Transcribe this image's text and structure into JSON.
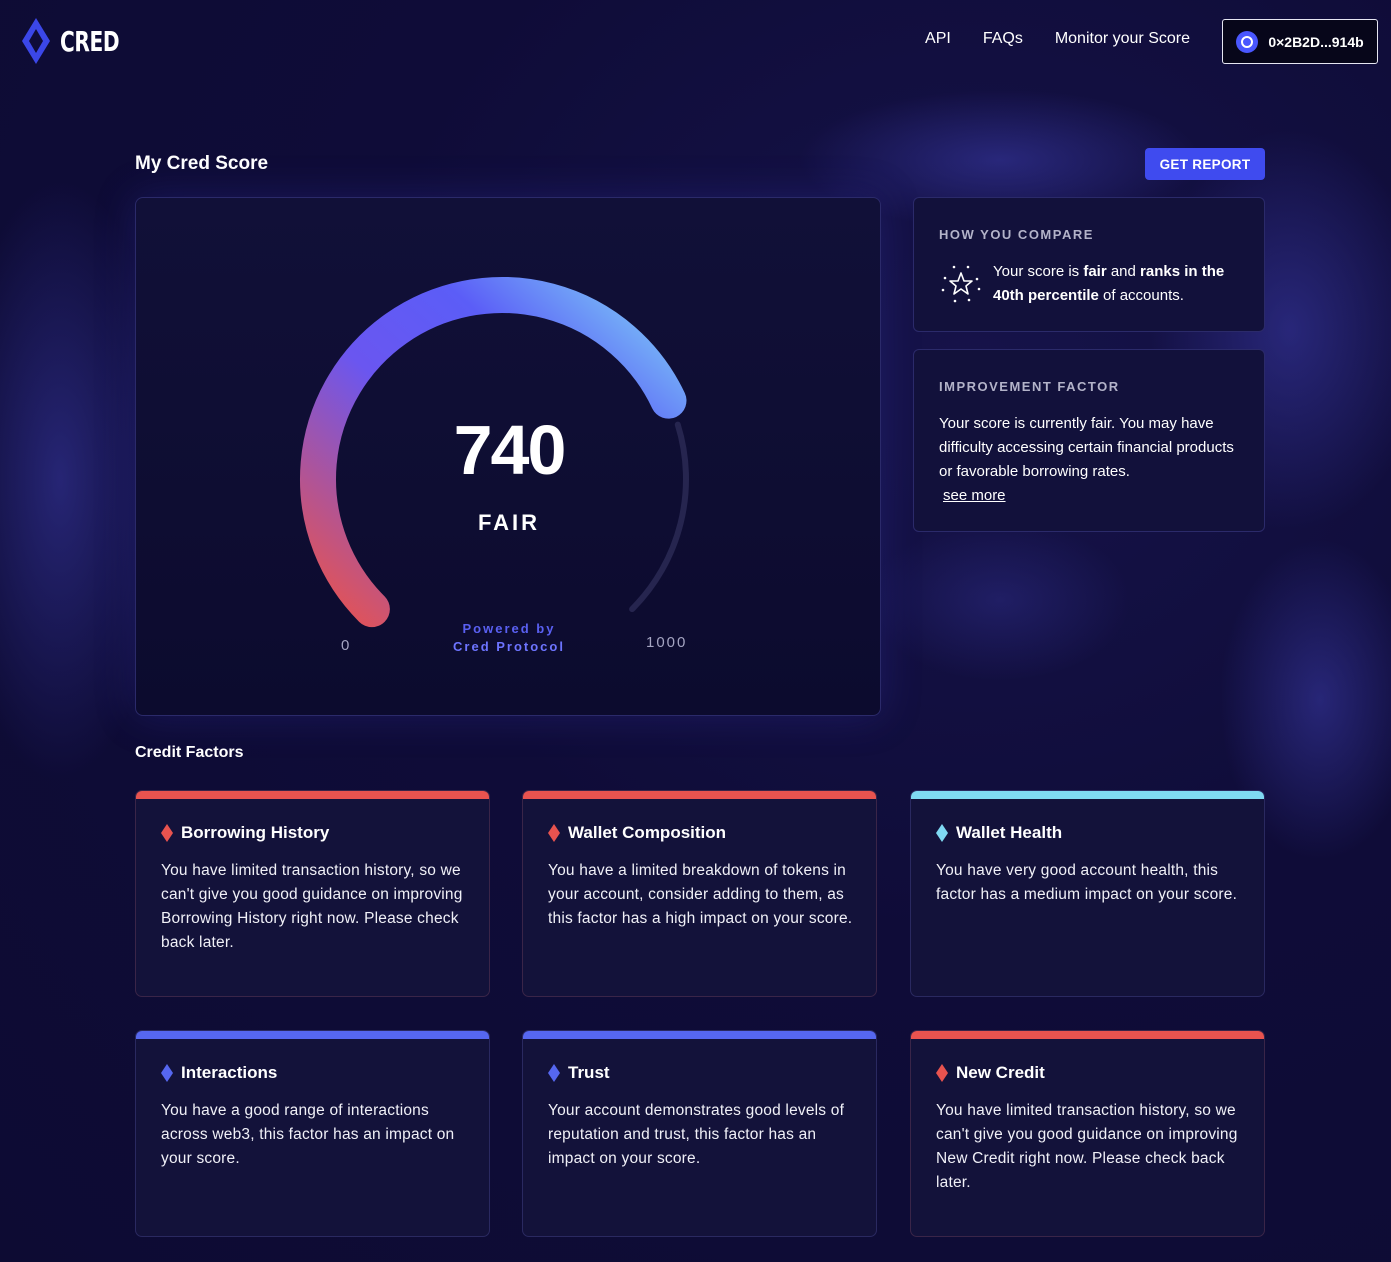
{
  "brand": {
    "name": "CRED"
  },
  "nav": {
    "items": [
      "API",
      "FAQs",
      "Monitor your Score"
    ],
    "wallet_address": "0×2B2D...914b"
  },
  "score_section": {
    "title": "My Cred Score",
    "report_button": "GET REPORT",
    "score": "740",
    "rating": "FAIR",
    "min_label": "0",
    "max_label": "1000",
    "score_fraction": 0.74,
    "powered_by": "Powered by",
    "powered_brand": "Cred Protocol"
  },
  "compare": {
    "title": "HOW YOU COMPARE",
    "text_1": "Your score is ",
    "text_2": "fair",
    "text_3": " and ",
    "text_4": "ranks in the 40th percentile",
    "text_5": " of accounts."
  },
  "improvement": {
    "title": "IMPROVEMENT FACTOR",
    "text": "Your score is currently fair. You may have difficulty accessing certain financial products or favorable borrowing rates.",
    "link": "see more"
  },
  "factors": {
    "title": "Credit Factors",
    "items": [
      {
        "name": "Borrowing History",
        "desc": "You have limited transaction history, so we can't give you good guidance on improving Borrowing History right now. Please check back later.",
        "color": "#e8534f"
      },
      {
        "name": "Wallet Composition",
        "desc": "You have a limited breakdown of tokens in your account, consider adding to them, as this factor has a high impact on your score.",
        "color": "#e8534f"
      },
      {
        "name": "Wallet Health",
        "desc": "You have very good account health, this factor has a medium impact on your score.",
        "color": "#7fd9f2"
      },
      {
        "name": "Interactions",
        "desc": "You have a good range of interactions across web3, this factor has an impact on your score.",
        "color": "#5667f0"
      },
      {
        "name": "Trust",
        "desc": "Your account demonstrates good levels of reputation and trust, this factor has an impact on your score.",
        "color": "#5667f0"
      },
      {
        "name": "New Credit",
        "desc": "You have limited transaction history, so we can't give you good guidance on improving New Credit right now. Please check back later.",
        "color": "#e8534f"
      }
    ]
  },
  "colors": {
    "background": "#0f0c38",
    "accent": "#3f4bef",
    "gauge_start": "#e8534f",
    "gauge_mid": "#5b5df7",
    "gauge_end": "#7fd0f7"
  }
}
